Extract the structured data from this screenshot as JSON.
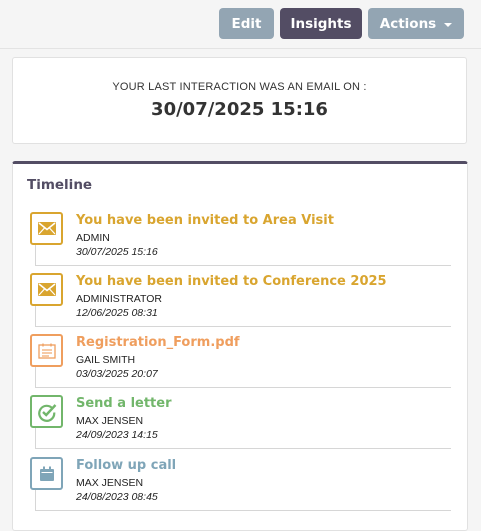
{
  "toolbar": {
    "edit_label": "Edit",
    "insights_label": "Insights",
    "actions_label": "Actions"
  },
  "last_interaction": {
    "label": "YOUR LAST INTERACTION WAS AN EMAIL ON :",
    "datetime": "30/07/2025 15:16"
  },
  "timeline": {
    "title": "Timeline",
    "items": [
      {
        "title": "You have been invited to Area Visit",
        "user": "ADMIN",
        "datetime": "30/07/2025 15:16",
        "icon": "envelope-icon",
        "color": "#d9a52f"
      },
      {
        "title": "You have been invited to Conference 2025",
        "user": "ADMINISTRATOR",
        "datetime": "12/06/2025 08:31",
        "icon": "envelope-icon",
        "color": "#d9a52f"
      },
      {
        "title": "Registration_Form.pdf",
        "user": "GAIL SMITH",
        "datetime": "03/03/2025 20:07",
        "icon": "document-icon",
        "color": "#ef9e5e"
      },
      {
        "title": "Send a letter",
        "user": "MAX JENSEN",
        "datetime": "24/09/2023 14:15",
        "icon": "task-check-icon",
        "color": "#72b66b"
      },
      {
        "title": "Follow up call",
        "user": "MAX JENSEN",
        "datetime": "24/08/2023 08:45",
        "icon": "calendar-icon",
        "color": "#7fa5b8"
      }
    ]
  }
}
